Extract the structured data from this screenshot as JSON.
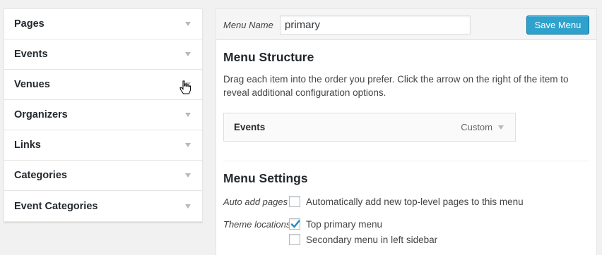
{
  "left_panel": {
    "items": [
      {
        "label": "Pages"
      },
      {
        "label": "Events"
      },
      {
        "label": "Venues"
      },
      {
        "label": "Organizers"
      },
      {
        "label": "Links"
      },
      {
        "label": "Categories"
      },
      {
        "label": "Event Categories"
      }
    ]
  },
  "header": {
    "menu_name_label": "Menu Name",
    "menu_name_value": "primary",
    "save_label": "Save Menu"
  },
  "structure": {
    "title": "Menu Structure",
    "description": "Drag each item into the order you prefer. Click the arrow on the right of the item to reveal additional configuration options.",
    "items": [
      {
        "title": "Events",
        "type": "Custom"
      }
    ]
  },
  "settings": {
    "title": "Menu Settings",
    "auto_add_label": "Auto add pages",
    "auto_add_text": "Automatically add new top-level pages to this menu",
    "auto_add_checked": false,
    "theme_locations_label": "Theme locations",
    "locations": [
      {
        "label": "Top primary menu",
        "checked": true
      },
      {
        "label": "Secondary menu in left sidebar",
        "checked": false
      }
    ]
  },
  "colors": {
    "accent": "#2ea2cc",
    "check": "#1e8cbe"
  }
}
